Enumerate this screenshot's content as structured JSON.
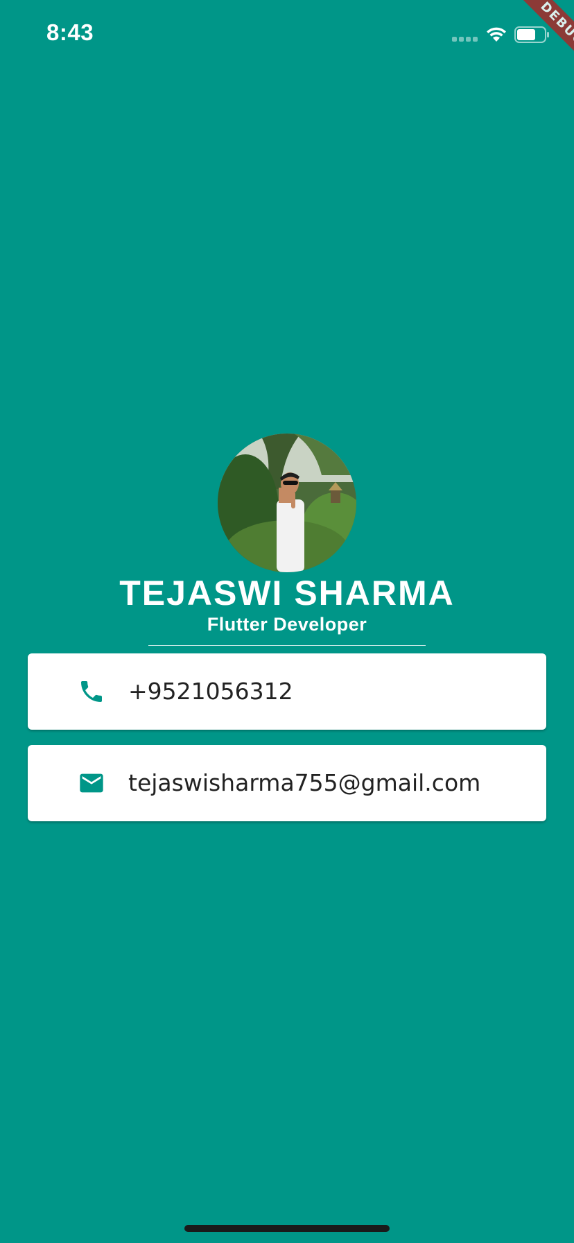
{
  "status_bar": {
    "time": "8:43"
  },
  "debug_banner": {
    "label": "DEBUG"
  },
  "profile": {
    "name": "TEJASWI SHARMA",
    "role": "Flutter Developer"
  },
  "contacts": {
    "phone": {
      "icon": "phone-icon",
      "value": "+9521056312"
    },
    "email": {
      "icon": "email-icon",
      "value": "tejaswisharma755@gmail.com"
    }
  },
  "colors": {
    "background": "#009688",
    "card": "#ffffff",
    "icon": "#009688",
    "debug_ribbon": "#a52a2a"
  }
}
